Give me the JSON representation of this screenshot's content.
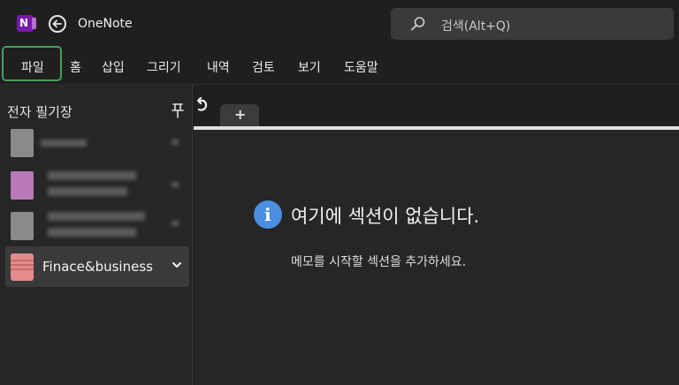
{
  "app": {
    "title": "OneNote"
  },
  "search": {
    "placeholder": "검색(Alt+Q)"
  },
  "ribbon": {
    "tabs": [
      "파일",
      "홈",
      "삽입",
      "그리기",
      "내역",
      "검토",
      "보기",
      "도움말"
    ]
  },
  "sidebar": {
    "heading": "전자 필기장",
    "selected_notebook": "Finace&business"
  },
  "sections": {
    "add_label": "+"
  },
  "empty_state": {
    "title": "여기에 섹션이 없습니다.",
    "subtitle": "메모를 시작할 섹션을 추가하세요."
  },
  "colors": {
    "accent_focus": "#3fa35a",
    "onenote_purple": "#7719aa",
    "notebook_pink": "#e58a8a",
    "info_blue": "#4a8fe0"
  },
  "icons": [
    "onenote-logo-icon",
    "back-arrow-icon",
    "search-icon",
    "pin-icon",
    "undo-icon",
    "chevron-down-icon",
    "info-icon",
    "notebook-icon"
  ]
}
